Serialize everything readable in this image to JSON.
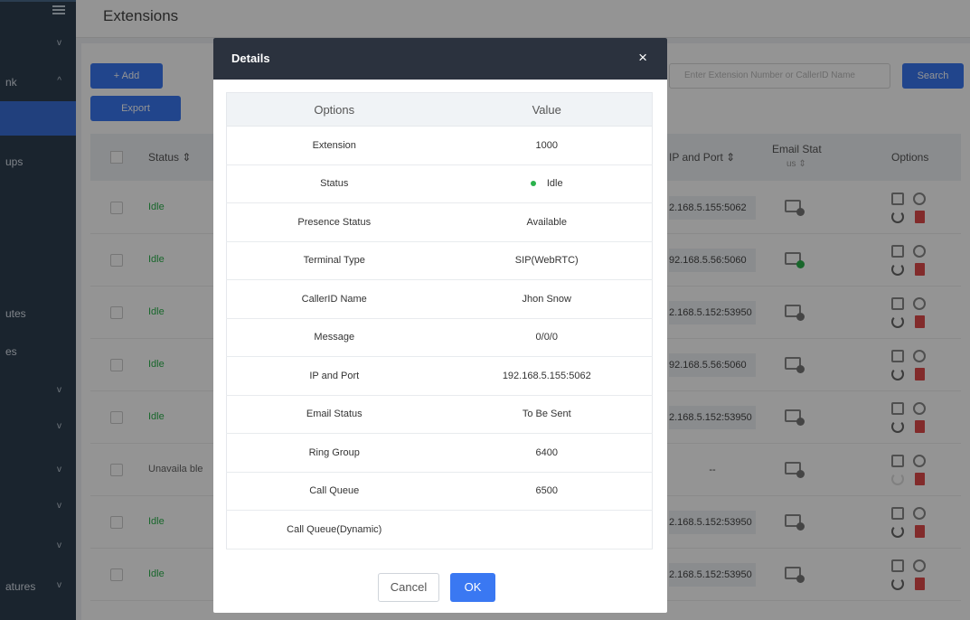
{
  "sidebar": {
    "items": [
      {
        "label": "nk",
        "chevron": "^"
      },
      {
        "label": "ups"
      },
      {
        "label": "utes"
      },
      {
        "label": "es"
      },
      {
        "label": "atures",
        "chevron": "v"
      }
    ]
  },
  "page": {
    "title": "Extensions",
    "add_label": "+ Add",
    "export_label": "Export",
    "search_placeholder": "Enter Extension Number or CallerID Name",
    "search_label": "Search"
  },
  "table": {
    "headers": {
      "status": "Status ⇕",
      "ip_port": "IP and Port ⇕",
      "email_status_1": "Email Stat",
      "email_status_2": "us ⇕",
      "options": "Options"
    },
    "rows": [
      {
        "status": "Idle",
        "ip": "2.168.5.155:5062"
      },
      {
        "status": "Idle",
        "ip": "92.168.5.56:5060"
      },
      {
        "status": "Idle",
        "ip": "2.168.5.152:53950"
      },
      {
        "status": "Idle",
        "ip": "92.168.5.56:5060"
      },
      {
        "status": "Idle",
        "ip": "2.168.5.152:53950"
      },
      {
        "status": "Unavaila ble",
        "ip": "--"
      },
      {
        "status": "Idle",
        "ip": "2.168.5.152:53950"
      },
      {
        "status": "Idle",
        "ip": "2.168.5.152:53950"
      }
    ]
  },
  "modal": {
    "title": "Details",
    "close": "×",
    "col_options": "Options",
    "col_value": "Value",
    "details": [
      {
        "option": "Extension",
        "value": "1000"
      },
      {
        "option": "Status",
        "value": "Idle"
      },
      {
        "option": "Presence Status",
        "value": "Available"
      },
      {
        "option": "Terminal Type",
        "value": "SIP(WebRTC)"
      },
      {
        "option": "CallerID Name",
        "value": "Jhon Snow"
      },
      {
        "option": "Message",
        "value": "0/0/0"
      },
      {
        "option": "IP and Port",
        "value": "192.168.5.155:5062"
      },
      {
        "option": "Email Status",
        "value": "To Be Sent"
      },
      {
        "option": "Ring Group",
        "value": "6400"
      },
      {
        "option": "Call Queue",
        "value": "6500"
      },
      {
        "option": "Call Queue(Dynamic)",
        "value": ""
      }
    ],
    "cancel_label": "Cancel",
    "ok_label": "OK"
  },
  "colors": {
    "primary": "#3a78f2",
    "idle": "#2bb24c",
    "modal_header": "#2b323e",
    "delete": "#e04b4b"
  }
}
